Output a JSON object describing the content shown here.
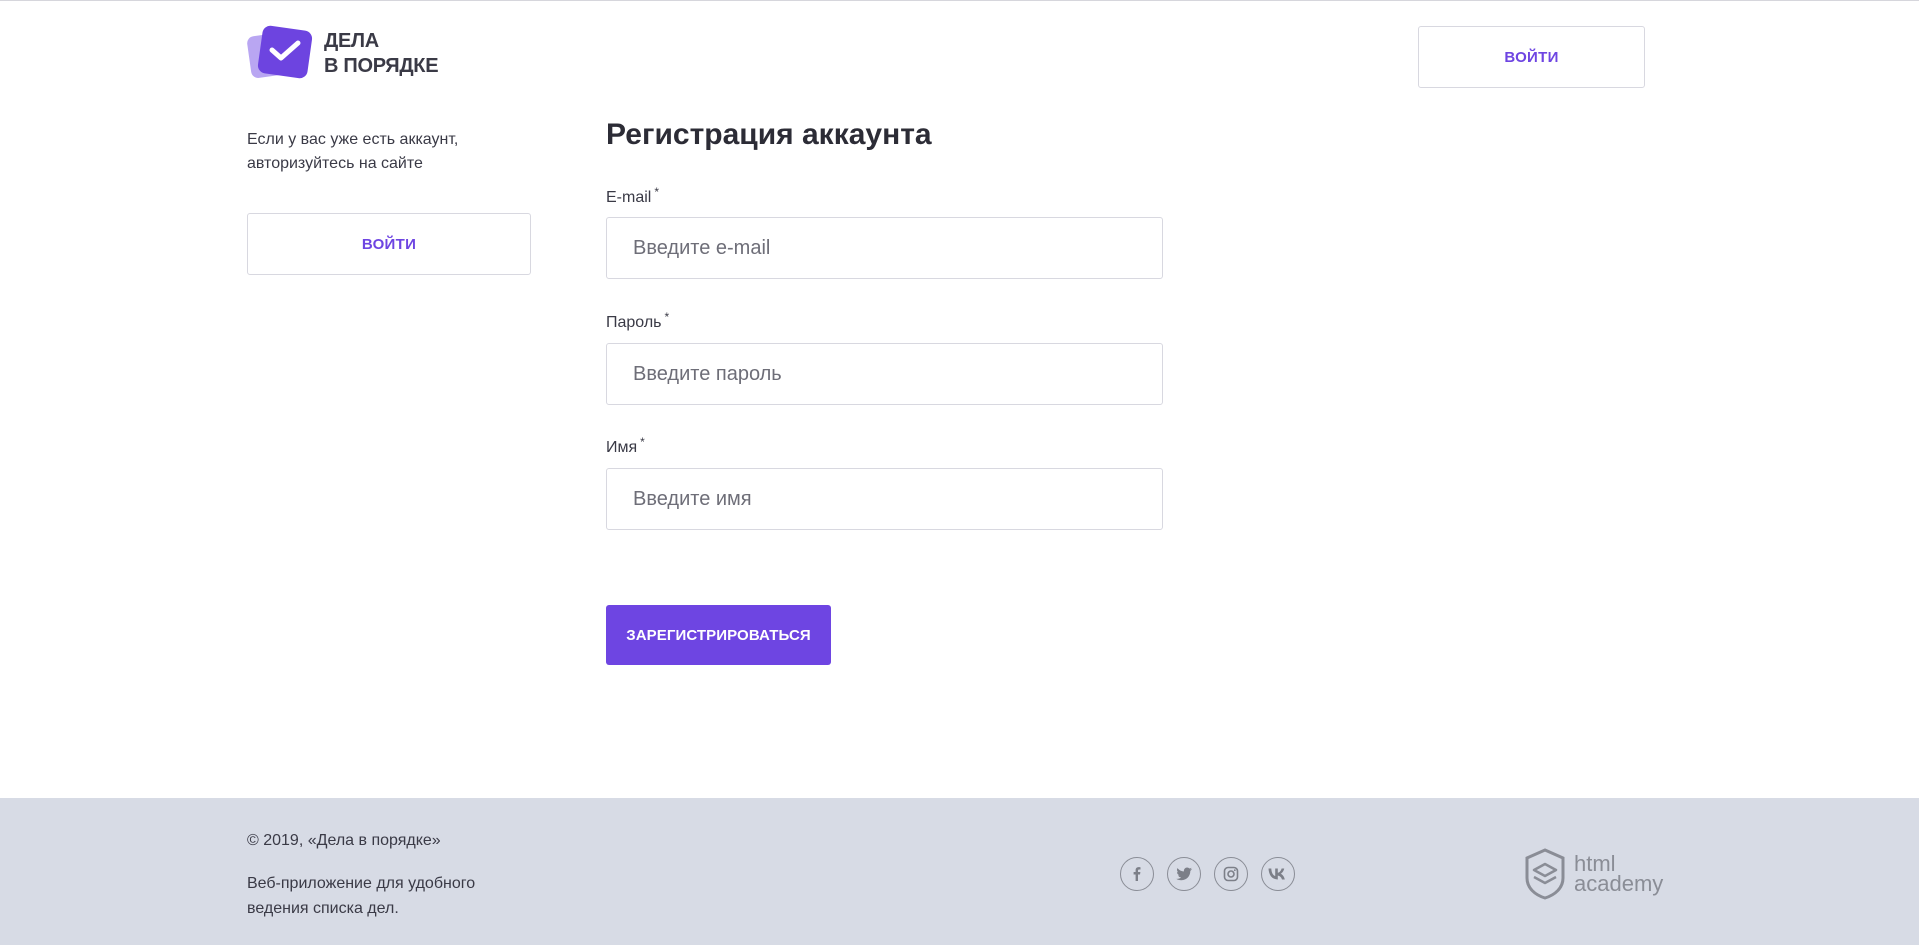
{
  "header": {
    "logo_line1": "ДЕЛА",
    "logo_line2": "В ПОРЯДКЕ",
    "login_label": "ВОЙТИ"
  },
  "sidebar": {
    "text": "Если у вас уже есть аккаунт, авторизуйтесь на сайте",
    "login_label": "ВОЙТИ"
  },
  "form": {
    "title": "Регистрация аккаунта",
    "email": {
      "label": "E-mail",
      "required_mark": "*",
      "placeholder": "Введите e-mail",
      "value": ""
    },
    "password": {
      "label": "Пароль",
      "required_mark": "*",
      "placeholder": "Введите пароль",
      "value": ""
    },
    "name": {
      "label": "Имя",
      "required_mark": "*",
      "placeholder": "Введите имя",
      "value": ""
    },
    "submit_label": "ЗАРЕГИСТРИРОВАТЬСЯ"
  },
  "footer": {
    "copyright": "© 2019, «Дела в порядке»",
    "description": "Веб-приложение для удобного ведения списка дел.",
    "socials": [
      "facebook-icon",
      "twitter-icon",
      "instagram-icon",
      "vk-icon"
    ],
    "academy_line1": "html",
    "academy_line2": "academy"
  },
  "colors": {
    "accent": "#6e45e2",
    "footer_bg": "#d7dbe5",
    "logo_light": "#b9a6f2"
  }
}
